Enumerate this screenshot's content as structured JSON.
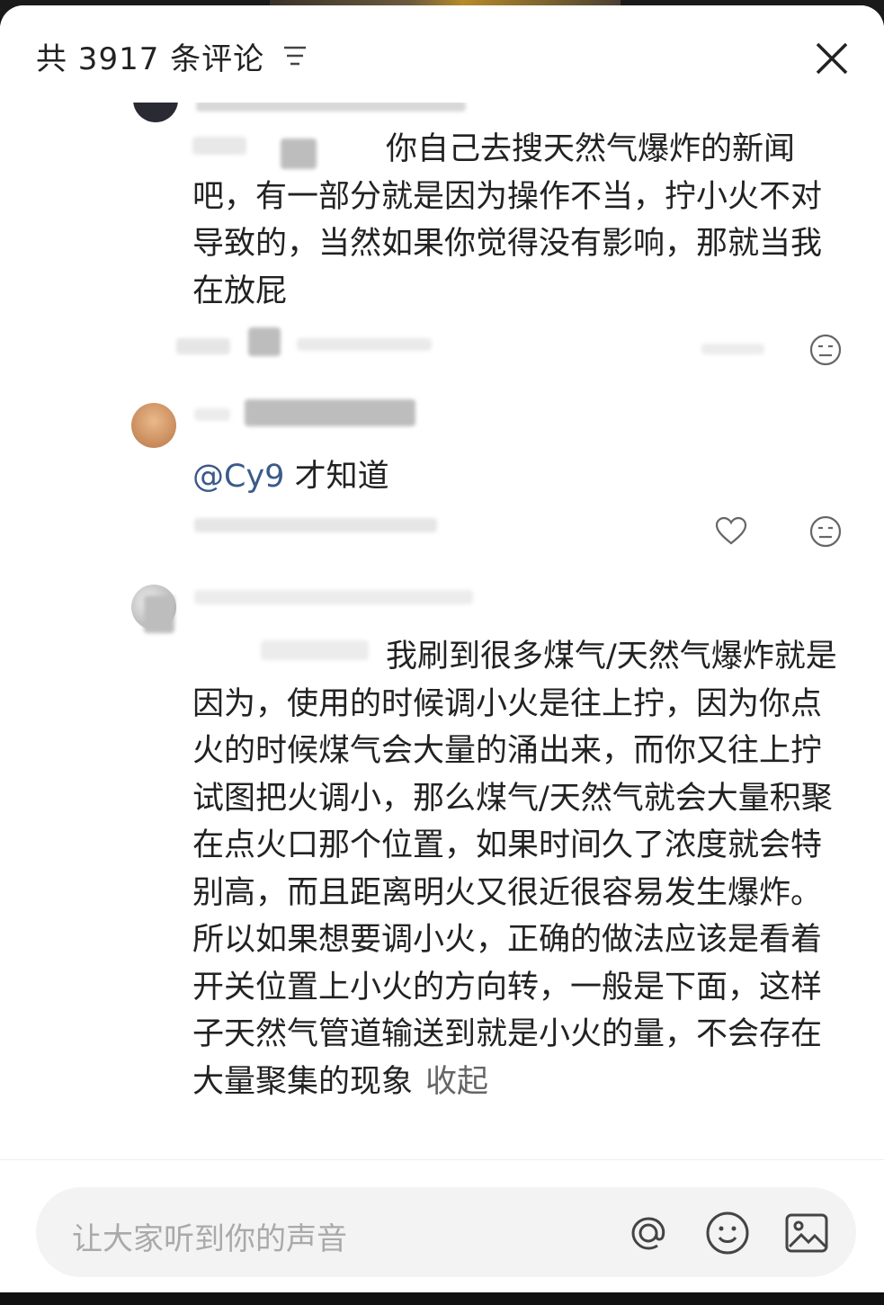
{
  "header": {
    "title": "共 3917 条评论"
  },
  "comments": [
    {
      "text": "你自己去搜天然气爆炸的新闻吧，有一部分就是因为操作不当，拧小火不对导致的，当然如果你觉得没有影响，那就当我在放屁"
    },
    {
      "mention": "@Cy9",
      "text": "才知道"
    },
    {
      "text": "我刷到很多煤气/天然气爆炸就是因为，使用的时候调小火是往上拧，因为你点火的时候煤气会大量的涌出来，而你又往上拧试图把火调小，那么煤气/天然气就会大量积聚在点火口那个位置，如果时间久了浓度就会特别高，而且距离明火又很近很容易发生爆炸。所以如果想要调小火，正确的做法应该是看着开关位置上小火的方向转，一般是下面，这样子天然气管道输送到就是小火的量，不会存在大量聚集的现象",
      "collapse": "收起"
    }
  ],
  "footer": {
    "placeholder": "让大家听到你的声音"
  },
  "icons": {
    "sort": "sort-icon",
    "close": "close-icon",
    "like": "heart-icon",
    "dislike": "meh-face-icon",
    "at": "at-icon",
    "emoji": "emoji-icon",
    "image": "image-icon"
  }
}
